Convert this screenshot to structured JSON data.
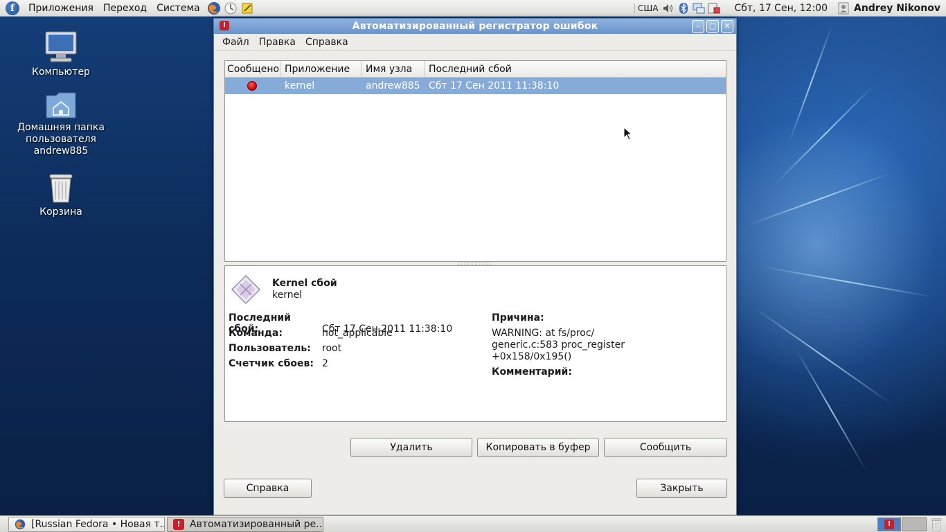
{
  "top_panel": {
    "menus": [
      "Приложения",
      "Переход",
      "Система"
    ],
    "kb_layout": "США",
    "clock": "Сбт, 17 Сен, 12:00",
    "user": "Andrey Nikonov"
  },
  "desktop": {
    "icons": [
      {
        "label": "Компьютер"
      },
      {
        "label": "Домашняя папка пользователя andrew885"
      },
      {
        "label": "Корзина"
      }
    ]
  },
  "window": {
    "title": "Автоматизированный регистратор ошибок",
    "menu": [
      "Файл",
      "Правка",
      "Справка"
    ],
    "list": {
      "columns": [
        "Сообщено",
        "Приложение",
        "Имя узла",
        "Последний сбой"
      ],
      "rows": [
        {
          "reported": "red",
          "app": "kernel",
          "host": "andrew885",
          "last_crash": "Сбт 17 Сен 2011 11:38:10"
        }
      ]
    },
    "detail": {
      "title": "Kernel сбой",
      "subtitle": "kernel",
      "fields": [
        {
          "key": "Последний сбой:",
          "value": "Сбт 17 Сен 2011 11:38:10"
        },
        {
          "key": "Команда:",
          "value": "not_applicable"
        },
        {
          "key": "Пользователь:",
          "value": "root"
        },
        {
          "key": "Счетчик сбоев:",
          "value": "2"
        }
      ],
      "reason_label": "Причина:",
      "reason_lines": [
        "WARNING: at fs/proc/",
        "generic.c:583 proc_register",
        "+0x158/0x195()"
      ],
      "comment_label": "Комментарий:"
    },
    "buttons": {
      "delete": "Удалить",
      "copy": "Копировать в буфер",
      "report": "Сообщить",
      "help": "Справка",
      "close": "Закрыть"
    }
  },
  "taskbar": {
    "tasks": [
      {
        "label": "[Russian Fedora • Новая т..."
      },
      {
        "label": "Автоматизированный ре..."
      }
    ]
  }
}
